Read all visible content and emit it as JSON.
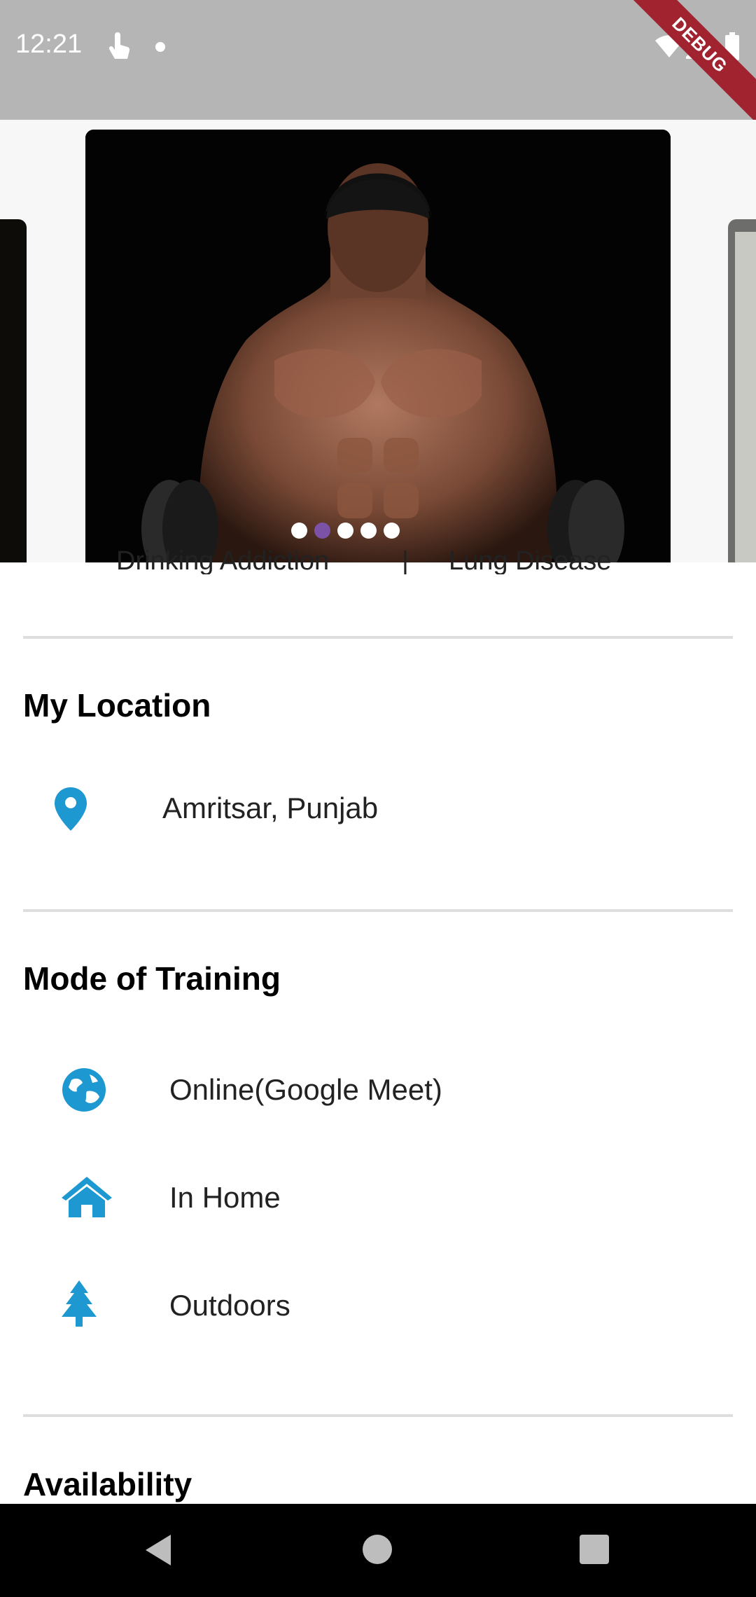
{
  "status_bar": {
    "time": "12:21",
    "debug_label": "DEBUG"
  },
  "carousel": {
    "image_alt": "bodybuilder-with-dumbbells",
    "dot_count": 5,
    "active_dot": 2,
    "active_color": "#7b52a6"
  },
  "tags": {
    "items": [
      "Drinking Addiction",
      "Lung Disease"
    ],
    "separator": "|"
  },
  "location": {
    "title": "My Location",
    "value": "Amritsar, Punjab",
    "icon": "location-pin-icon"
  },
  "training": {
    "title": "Mode of Training",
    "modes": [
      {
        "label": "Online(Google Meet)",
        "icon": "globe-icon"
      },
      {
        "label": "In Home",
        "icon": "home-icon"
      },
      {
        "label": "Outdoors",
        "icon": "tree-icon"
      }
    ]
  },
  "availability": {
    "title": "Availability"
  },
  "colors": {
    "accent": "#1e98d0",
    "status_bar": "#b5b5b5",
    "divider": "#dedede"
  }
}
